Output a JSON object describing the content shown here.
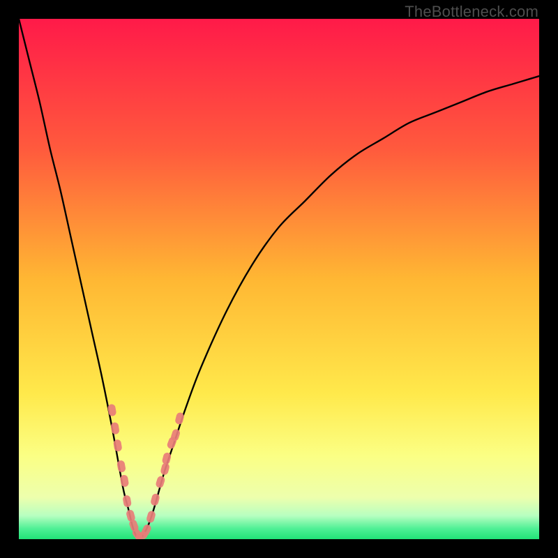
{
  "watermark": "TheBottleneck.com",
  "colors": {
    "frame": "#000000",
    "curve": "#000000",
    "marker_fill": "#e87d78",
    "marker_stroke": "#e87d78",
    "bottom_band": "#2fe57f",
    "gradient_stops": [
      {
        "offset": 0,
        "color": "#ff1a49"
      },
      {
        "offset": 0.25,
        "color": "#ff5a3d"
      },
      {
        "offset": 0.5,
        "color": "#ffb733"
      },
      {
        "offset": 0.72,
        "color": "#ffe94b"
      },
      {
        "offset": 0.84,
        "color": "#fbff84"
      },
      {
        "offset": 0.92,
        "color": "#edffad"
      },
      {
        "offset": 0.955,
        "color": "#b7ffc0"
      },
      {
        "offset": 0.98,
        "color": "#4ef095"
      },
      {
        "offset": 1.0,
        "color": "#21e377"
      }
    ]
  },
  "chart_data": {
    "type": "line",
    "title": "",
    "xlabel": "",
    "ylabel": "",
    "xlim": [
      0,
      100
    ],
    "ylim": [
      0,
      100
    ],
    "grid": false,
    "legend": false,
    "note": "V-shaped bottleneck curve; y approximates percent bottleneck (0 at trough ≈ x=23). Values estimated from pixel positions.",
    "series": [
      {
        "name": "bottleneck_curve",
        "x": [
          0,
          2,
          4,
          6,
          8,
          10,
          12,
          14,
          16,
          18,
          20,
          21,
          22,
          23,
          24,
          25,
          26,
          28,
          30,
          32,
          35,
          40,
          45,
          50,
          55,
          60,
          65,
          70,
          75,
          80,
          85,
          90,
          95,
          100
        ],
        "y": [
          100,
          92,
          84,
          75,
          67,
          58,
          49,
          40,
          31,
          21,
          10,
          6,
          2,
          0,
          1,
          3,
          6,
          13,
          19,
          25,
          33,
          44,
          53,
          60,
          65,
          70,
          74,
          77,
          80,
          82,
          84,
          86,
          87.5,
          89
        ]
      }
    ],
    "markers": {
      "name": "highlighted_points",
      "note": "Salmon rounded markers clustered near the trough on both arms",
      "points": [
        {
          "x": 17.9,
          "y": 24.8
        },
        {
          "x": 18.5,
          "y": 21.3
        },
        {
          "x": 19.0,
          "y": 18.0
        },
        {
          "x": 19.7,
          "y": 14.0
        },
        {
          "x": 20.3,
          "y": 11.2
        },
        {
          "x": 20.8,
          "y": 7.3
        },
        {
          "x": 21.5,
          "y": 4.5
        },
        {
          "x": 22.1,
          "y": 2.6
        },
        {
          "x": 22.8,
          "y": 0.9
        },
        {
          "x": 23.6,
          "y": 0.6
        },
        {
          "x": 24.5,
          "y": 1.7
        },
        {
          "x": 25.4,
          "y": 4.3
        },
        {
          "x": 26.2,
          "y": 7.6
        },
        {
          "x": 27.2,
          "y": 11.0
        },
        {
          "x": 28.1,
          "y": 13.5
        },
        {
          "x": 28.4,
          "y": 15.5
        },
        {
          "x": 29.4,
          "y": 18.5
        },
        {
          "x": 30.1,
          "y": 20.0
        },
        {
          "x": 30.9,
          "y": 23.2
        }
      ]
    }
  }
}
